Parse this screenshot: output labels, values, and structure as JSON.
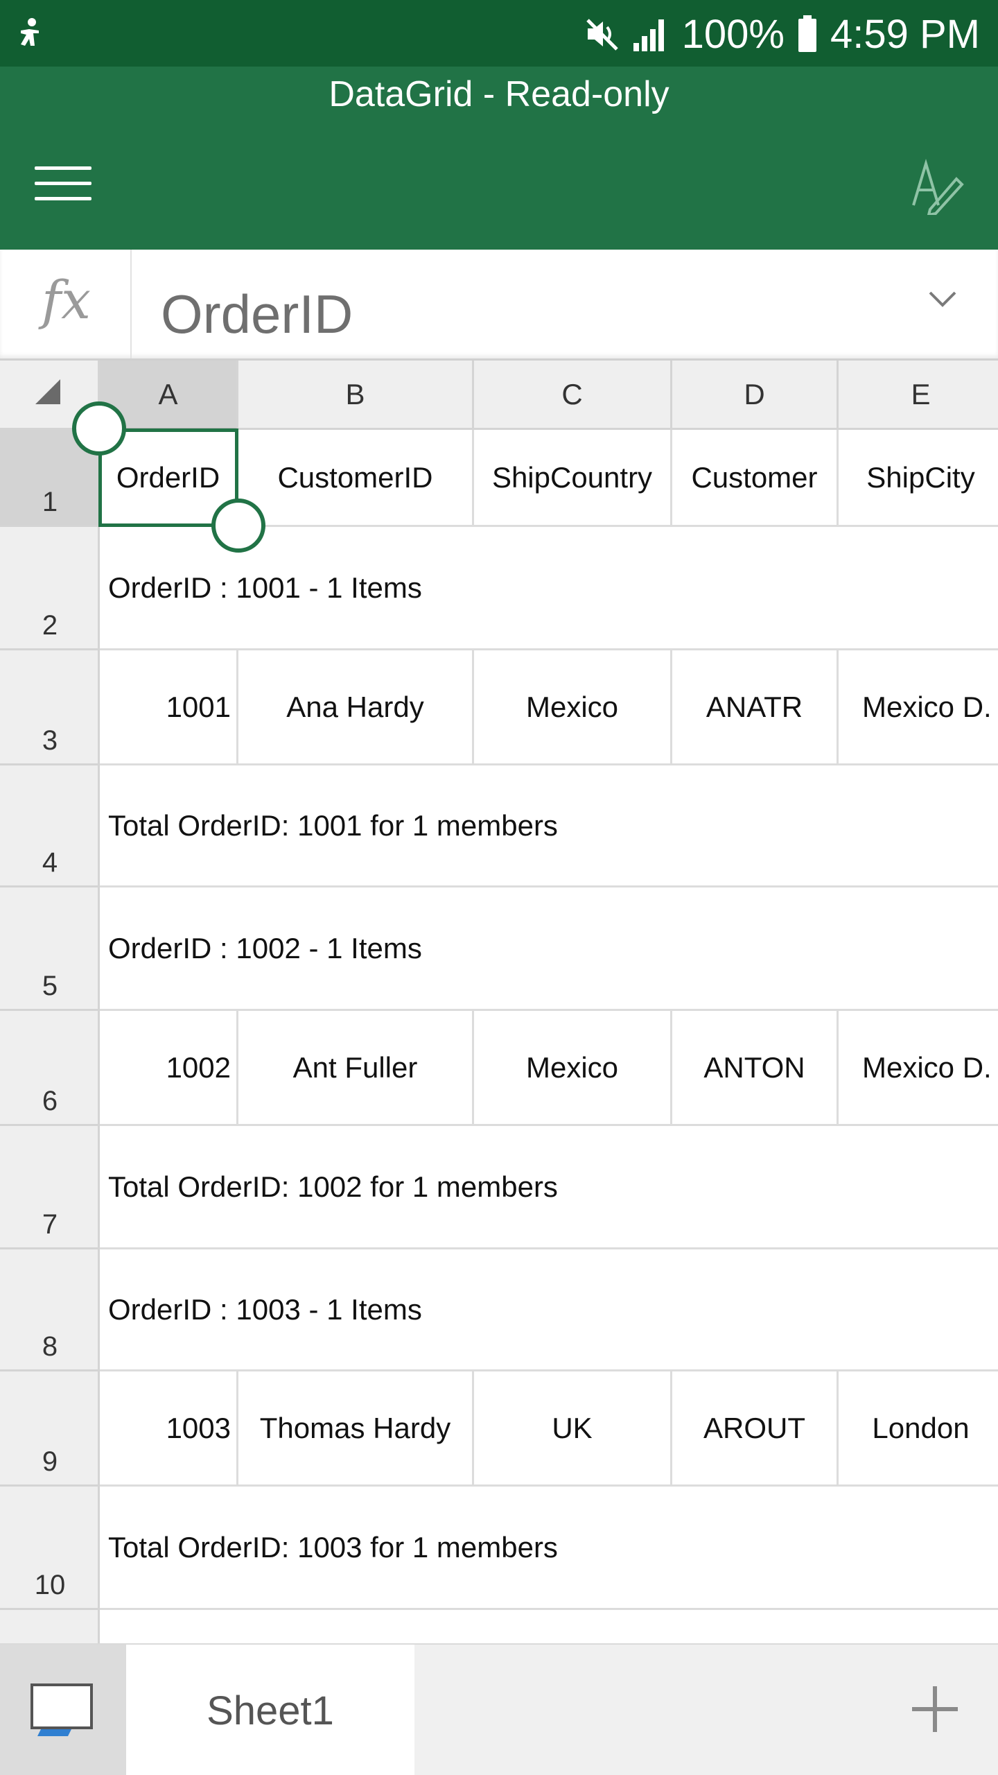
{
  "status_bar": {
    "battery": "100%",
    "time": "4:59 PM"
  },
  "app": {
    "title": "DataGrid - Read-only"
  },
  "formula_bar": {
    "fx_label": "fx",
    "value": "OrderID"
  },
  "columns": [
    "A",
    "B",
    "C",
    "D",
    "E"
  ],
  "selected_cell": "A1",
  "rows": [
    {
      "num": "1",
      "type": "cells",
      "cells": [
        "OrderID",
        "CustomerID",
        "ShipCountry",
        "Customer",
        "ShipCity"
      ]
    },
    {
      "num": "2",
      "type": "caption",
      "text": "OrderID : 1001 - 1 Items"
    },
    {
      "num": "3",
      "type": "cells",
      "cells": [
        "1001",
        "Ana Hardy",
        "Mexico",
        "ANATR",
        "Mexico D."
      ]
    },
    {
      "num": "4",
      "type": "caption",
      "text": "Total OrderID: 1001 for 1 members"
    },
    {
      "num": "5",
      "type": "caption",
      "text": "OrderID : 1002 - 1 Items"
    },
    {
      "num": "6",
      "type": "cells",
      "cells": [
        "1002",
        "Ant Fuller",
        "Mexico",
        "ANTON",
        "Mexico D."
      ]
    },
    {
      "num": "7",
      "type": "caption",
      "text": "Total OrderID: 1002 for 1 members"
    },
    {
      "num": "8",
      "type": "caption",
      "text": "OrderID : 1003 - 1 Items"
    },
    {
      "num": "9",
      "type": "cells",
      "cells": [
        "1003",
        "Thomas Hardy",
        "UK",
        "AROUT",
        "London"
      ]
    },
    {
      "num": "10",
      "type": "caption",
      "text": "Total OrderID: 1003 for 1 members"
    }
  ],
  "sheet_tabs": {
    "active": "Sheet1"
  },
  "colors": {
    "status_bar": "#115e31",
    "title_bar": "#217346",
    "selection": "#217346"
  }
}
